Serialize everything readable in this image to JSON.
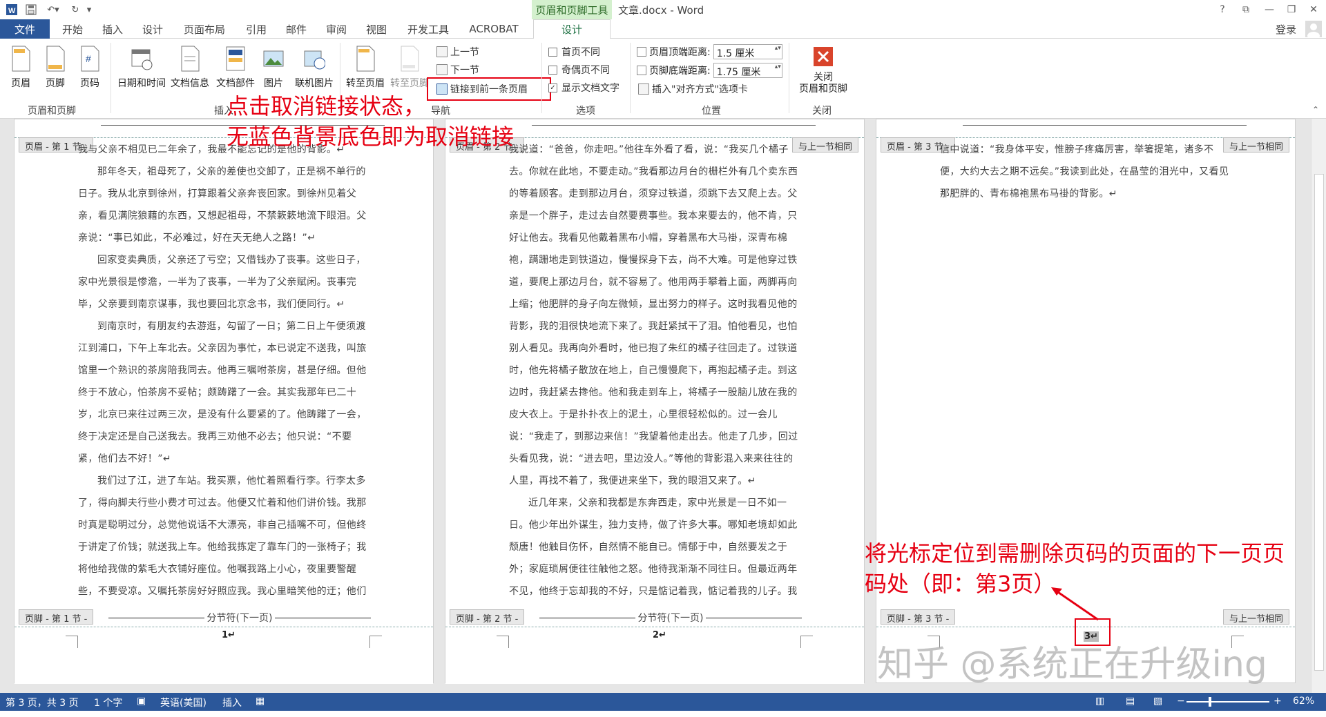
{
  "titlebar": {
    "context_tab_title": "页眉和页脚工具",
    "doc_title": "文章.docx - Word",
    "help": "?",
    "restore_ribbon": "⧉",
    "minimize": "—",
    "maximize": "❐",
    "close": "✕"
  },
  "tabs": [
    "文件",
    "开始",
    "插入",
    "设计",
    "页面布局",
    "引用",
    "邮件",
    "审阅",
    "视图",
    "开发工具",
    "ACROBAT",
    "设计"
  ],
  "signin": "登录",
  "ribbon": {
    "insert_buttons": [
      "页眉",
      "页脚",
      "页码"
    ],
    "group_header_footer": "页眉和页脚",
    "date_time": "日期和时间",
    "doc_info": "文档信息",
    "doc_parts": "文档部件",
    "picture": "图片",
    "online_picture": "联机图片",
    "group_insert": "插入",
    "goto_header": "转至页眉",
    "goto_footer": "转至页脚",
    "prev_section": "上一节",
    "next_section": "下一节",
    "link_previous": "链接到前一条页眉",
    "group_nav": "导航",
    "opt_first_page": "首页不同",
    "opt_odd_even": "奇偶页不同",
    "opt_show_text": "显示文档文字",
    "group_options": "选项",
    "header_top_label": "页眉顶端距离:",
    "header_top_value": "1.5 厘米",
    "footer_bottom_label": "页脚底端距离:",
    "footer_bottom_value": "1.75 厘米",
    "insert_align_tab": "插入\"对齐方式\"选项卡",
    "group_position": "位置",
    "close_btn_line1": "关闭",
    "close_btn_line2": "页眉和页脚",
    "group_close": "关闭"
  },
  "annotations": {
    "top_line1": "点击取消链接状态，",
    "top_line2": "无蓝色背景底色即为取消链接",
    "bottom_line1": "将光标定位到需删除页码的页面的下一页页",
    "bottom_line2": "码处（即：第3页）"
  },
  "watermark": "知乎 @系统正在升级ing",
  "pages": [
    {
      "header_tag": "页眉 - 第 1 节 -",
      "header_same": "",
      "footer_tag": "页脚 - 第 1 节 -",
      "footer_same": "",
      "page_number": "1↵",
      "section_break": "分节符(下一页)",
      "paragraphs": [
        "我与父亲不相见已二年余了，我最不能忘记的是他的背影。↵",
        "那年冬天，祖母死了，父亲的差使也交卸了，正是祸不单行的日子。我从北京到徐州，打算跟着父亲奔丧回家。到徐州见着父亲，看见满院狼藉的东西，又想起祖母，不禁簌簌地流下眼泪。父亲说：“事已如此，不必难过，好在天无绝人之路！”↵",
        "回家变卖典质，父亲还了亏空；又借钱办了丧事。这些日子，家中光景很是惨澹，一半为了丧事，一半为了父亲赋闲。丧事完毕，父亲要到南京谋事，我也要回北京念书，我们便同行。↵",
        "到南京时，有朋友约去游逛，勾留了一日；第二日上午便须渡江到浦口，下午上车北去。父亲因为事忙，本已说定不送我，叫旅馆里一个熟识的茶房陪我同去。他再三嘱咐茶房，甚是仔细。但他终于不放心，怕茶房不妥帖；颇踌躇了一会。其实我那年已二十岁，北京已来往过两三次，是没有什么要紧的了。他踌躇了一会，终于决定还是自己送我去。我再三劝他不必去；他只说：“不要紧，他们去不好！”↵",
        "我们过了江，进了车站。我买票，他忙着照看行李。行李太多了，得向脚夫行些小费才可过去。他便又忙着和他们讲价钱。我那时真是聪明过分，总觉他说话不大漂亮，非自己插嘴不可，但他终于讲定了价钱；就送我上车。他给我拣定了靠车门的一张椅子；我将他给我做的紫毛大衣铺好座位。他嘱我路上小心，夜里要警醒些，不要受凉。又嘱托茶房好好照应我。我心里暗笑他的迂；他们只认得钱，托他们只是白托！而且我这样大年纪的人，难道还不能料理自己么？我现在想想，我那时真是太聪明了。"
      ]
    },
    {
      "header_tag": "页眉 - 第 2 节 -",
      "header_same": "与上一节相同",
      "footer_tag": "页脚 - 第 2 节 -",
      "footer_same": "",
      "page_number": "2↵",
      "section_break": "分节符(下一页)",
      "paragraphs": [
        "我说道：“爸爸，你走吧。”他往车外看了看，说：“我买几个橘子去。你就在此地，不要走动。”我看那边月台的栅栏外有几个卖东西的等着顾客。走到那边月台，须穿过铁道，须跳下去又爬上去。父亲是一个胖子，走过去自然要费事些。我本来要去的，他不肯，只好让他去。我看见他戴着黑布小帽，穿着黑布大马褂，深青布棉袍，蹒跚地走到铁道边，慢慢探身下去，尚不大难。可是他穿过铁道，要爬上那边月台，就不容易了。他用两手攀着上面，两脚再向上缩；他肥胖的身子向左微倾，显出努力的样子。这时我看见他的背影，我的泪很快地流下来了。我赶紧拭干了泪。怕他看见，也怕别人看见。我再向外看时，他已抱了朱红的橘子往回走了。过铁道时，他先将橘子散放在地上，自己慢慢爬下，再抱起橘子走。到这边时，我赶紧去搀他。他和我走到车上，将橘子一股脑儿放在我的皮大衣上。于是扑扑衣上的泥土，心里很轻松似的。过一会儿说：“我走了，到那边来信！”我望着他走出去。他走了几步，回过头看见我，说：“进去吧，里边没人。”等他的背影混入来来往往的人里，再找不着了，我便进来坐下，我的眼泪又来了。↵",
        "近几年来，父亲和我都是东奔西走，家中光景是一日不如一日。他少年出外谋生，独力支持，做了许多大事。哪知老境却如此颓唐！他触目伤怀，自然情不能自已。情郁于中，自然要发之于外；家庭琐屑便往往触他之怒。他待我渐渐不同往日。但最近两年不见，他终于忘却我的不好，只是惦记着我，惦记着我的儿子。我北来后，他写了一信给我。"
      ]
    },
    {
      "header_tag": "页眉 - 第 3 节 -",
      "header_same": "与上一节相同",
      "footer_tag": "页脚 - 第 3 节 -",
      "footer_same": "与上一节相同",
      "page_number": "3↵",
      "section_break": "",
      "paragraphs": [
        "信中说道：“我身体平安，惟膀子疼痛厉害，举箸提笔，诸多不便，大约大去之期不远矣。”我读到此处，在晶莹的泪光中，又看见那肥胖的、青布棉袍黑布马褂的背影。↵"
      ]
    }
  ],
  "statusbar": {
    "page_info": "第 3 页，共 3 页",
    "word_count": "1 个字",
    "language": "英语(美国)",
    "insert_mode": "插入",
    "zoom_minus": "−",
    "zoom_plus": "+",
    "zoom": "62%"
  },
  "colors": {
    "accent": "#2b579a",
    "context_tab": "#d4f0ce",
    "annotation": "#e60012"
  }
}
